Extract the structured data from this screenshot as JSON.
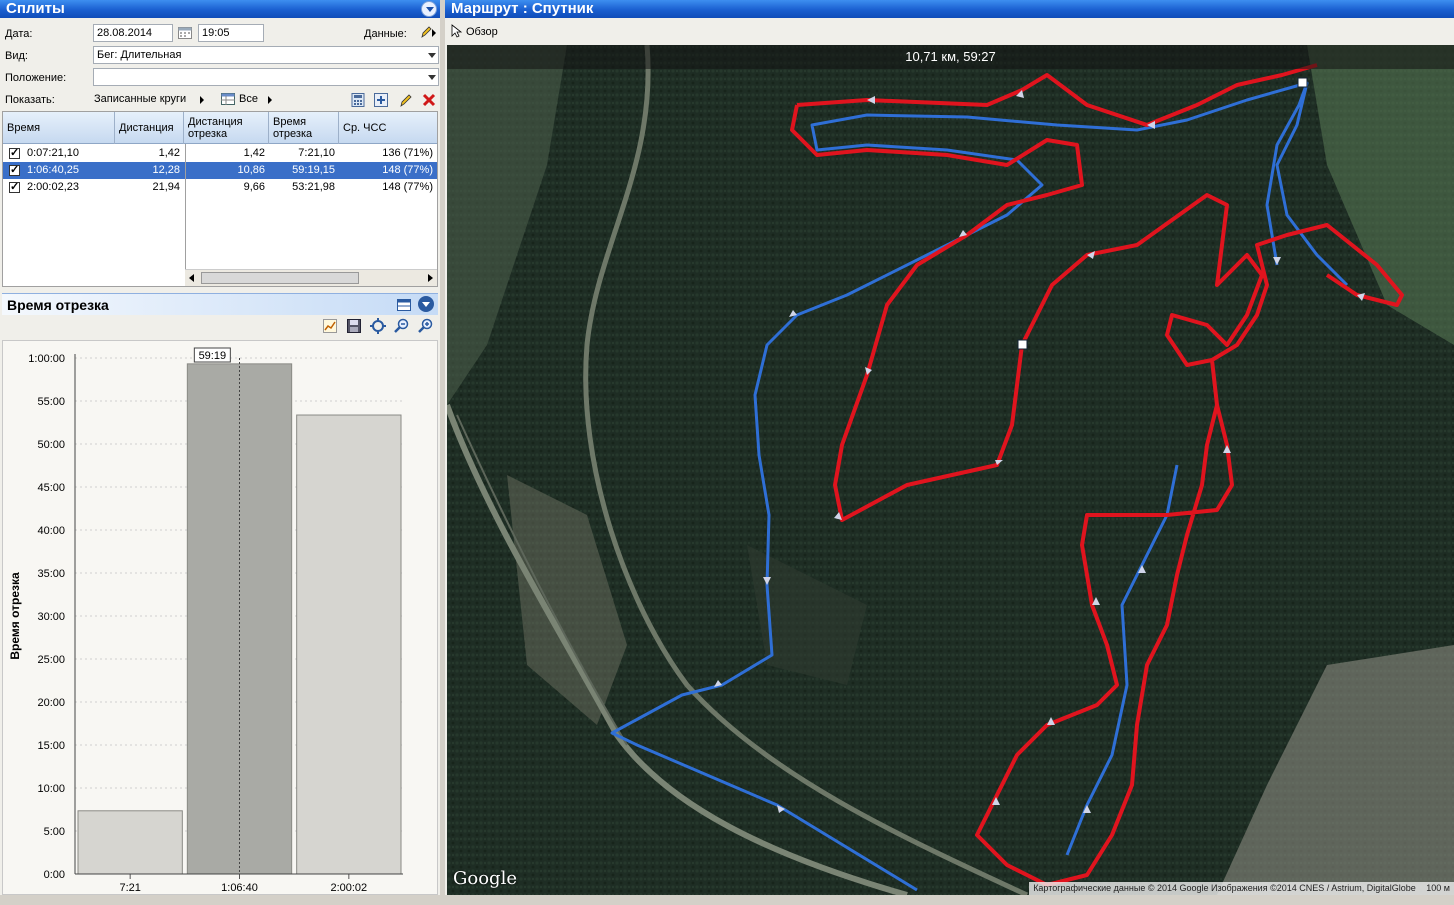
{
  "left_panel": {
    "title": "Сплиты",
    "date_label": "Дата:",
    "date_value": "28.08.2014",
    "time_value": "19:05",
    "data_label": "Данные:",
    "view_label": "Вид:",
    "view_value": "Бег: Длительная",
    "position_label": "Положение:",
    "position_value": "",
    "show_label": "Показать:",
    "show_value": "Записанные круги",
    "filter_value": "Все",
    "grid": {
      "headers": [
        "Время",
        "Дистанция",
        "Дистанция отрезка",
        "Время отрезка",
        "Ср. ЧСС"
      ],
      "rows": [
        {
          "time": "0:07:21,10",
          "distance": "1,42",
          "seg_distance": "1,42",
          "seg_time": "7:21,10",
          "hr": "136 (71%)",
          "selected": false
        },
        {
          "time": "1:06:40,25",
          "distance": "12,28",
          "seg_distance": "10,86",
          "seg_time": "59:19,15",
          "hr": "148 (77%)",
          "selected": true
        },
        {
          "time": "2:00:02,23",
          "distance": "21,94",
          "seg_distance": "9,66",
          "seg_time": "53:21,98",
          "hr": "148 (77%)",
          "selected": false
        }
      ]
    }
  },
  "chart_panel": {
    "title": "Время отрезка"
  },
  "chart_data": {
    "type": "bar",
    "categories": [
      "7:21",
      "1:06:40",
      "2:00:02"
    ],
    "values_minutes": [
      7.35,
      59.32,
      53.37
    ],
    "ylabel": "Время отрезка",
    "yticks": [
      "0:00",
      "5:00",
      "10:00",
      "15:00",
      "20:00",
      "25:00",
      "30:00",
      "35:00",
      "40:00",
      "45:00",
      "50:00",
      "55:00",
      "1:00:00"
    ],
    "ylim_minutes": [
      0,
      60
    ],
    "highlight_label": "59:19",
    "highlight_index": 1
  },
  "right_panel": {
    "title": "Маршрут : Спутник",
    "overview_label": "Обзор",
    "map_stat": "10,71 км, 59:27",
    "logo": "Google",
    "attribution": "Картографические данные © 2014 Google Изображения ©2014 CNES / Astrium, DigitalGlobe",
    "scale_label": "100 м"
  },
  "colors": {
    "title_blue": "#1a5fd0",
    "route_red": "#e0141e",
    "route_blue": "#2f6fd6",
    "selected_row": "#3a6fc8"
  }
}
